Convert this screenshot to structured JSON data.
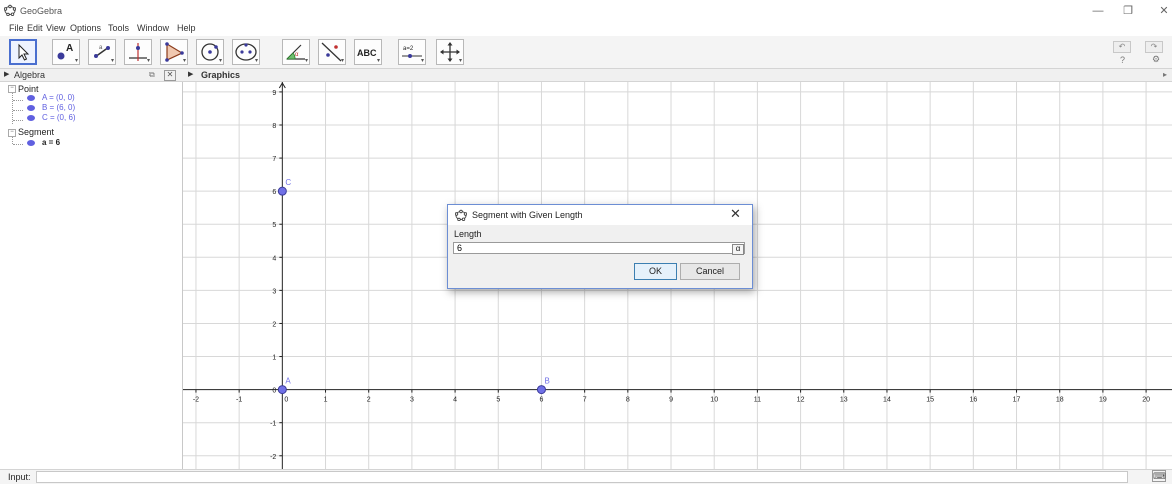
{
  "app": {
    "title": "GeoGebra",
    "icon": "geogebra-logo-icon"
  },
  "window_controls": {
    "minimize": "—",
    "restore": "❐",
    "close": "✕"
  },
  "menu": [
    {
      "label": "File"
    },
    {
      "label": "Edit"
    },
    {
      "label": "View"
    },
    {
      "label": "Options"
    },
    {
      "label": "Tools"
    },
    {
      "label": "Window"
    },
    {
      "label": "Help"
    }
  ],
  "toolbar": {
    "tools": [
      {
        "name": "move-tool",
        "icon": "arrow-pointer-icon",
        "selected": true
      },
      {
        "name": "point-tool",
        "icon": "point-icon",
        "label": "A"
      },
      {
        "name": "line-tool",
        "icon": "line-through-two-points-icon"
      },
      {
        "name": "perpendicular-line-tool",
        "icon": "perpendicular-line-icon"
      },
      {
        "name": "polygon-tool",
        "icon": "polygon-icon"
      },
      {
        "name": "circle-tool",
        "icon": "circle-with-center-icon"
      },
      {
        "name": "ellipse-tool",
        "icon": "ellipse-icon"
      },
      {
        "name": "angle-tool",
        "icon": "angle-icon"
      },
      {
        "name": "reflect-tool",
        "icon": "reflect-about-line-icon"
      },
      {
        "name": "text-tool",
        "icon": "text-icon",
        "label": "ABC"
      },
      {
        "name": "slider-tool",
        "icon": "slider-icon",
        "label": "a = 2"
      },
      {
        "name": "move-graphics-tool",
        "icon": "move-graphics-view-icon"
      }
    ],
    "undo_icon": "undo-icon",
    "redo_icon": "redo-icon",
    "help": "?",
    "settings_icon": "gear-icon"
  },
  "algebra": {
    "header": "Algebra",
    "categories": [
      {
        "label": "Point",
        "items": [
          "A = (0, 0)",
          "B = (6, 0)",
          "C = (0, 6)"
        ],
        "color": "#6060e0"
      },
      {
        "label": "Segment",
        "items": [
          "a = 6"
        ],
        "color": "#222222"
      }
    ]
  },
  "graphics": {
    "header": "Graphics",
    "x_range": [
      -2.3,
      20.6
    ],
    "y_range": [
      -2.4,
      9.3
    ],
    "x_ticks": [
      "-2",
      "-1",
      "0",
      "1",
      "2",
      "3",
      "4",
      "5",
      "6",
      "7",
      "8",
      "9",
      "10",
      "11",
      "12",
      "13",
      "14",
      "15",
      "16",
      "17",
      "18",
      "19",
      "20"
    ],
    "y_ticks": [
      "-2",
      "-1",
      "0",
      "1",
      "2",
      "3",
      "4",
      "5",
      "6",
      "7",
      "8",
      "9"
    ],
    "points": [
      {
        "label": "A",
        "x": 0,
        "y": 0
      },
      {
        "label": "B",
        "x": 6,
        "y": 0
      },
      {
        "label": "C",
        "x": 0,
        "y": 6
      }
    ],
    "point_color": "#7070e6"
  },
  "dialog": {
    "title": "Segment with Given Length",
    "field_label": "Length",
    "field_value": "6",
    "alpha_button": "α",
    "ok_label": "OK",
    "cancel_label": "Cancel",
    "close": "✕"
  },
  "input_bar": {
    "label": "Input:",
    "keyboard_icon": "keyboard-icon"
  }
}
